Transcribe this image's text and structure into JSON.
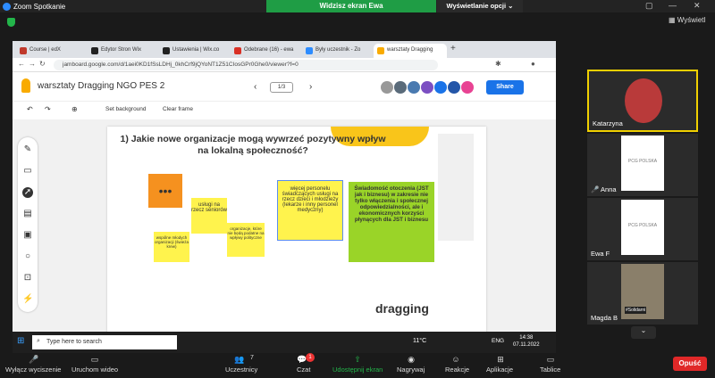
{
  "zoom": {
    "window_title": "Zoom Spotkanie",
    "share_banner": "Widzisz ekran Ewa",
    "view_options": "Wyświetlanie opcji ⌄",
    "gallery_view": "Wyświetl",
    "leave": "Opuść"
  },
  "browser": {
    "tabs": [
      "Course | edX",
      "Edytor Stron Wix",
      "Ustawienia | Wix.co",
      "Odebrane (16) - ewa",
      "Były uczestnik - Zo",
      "warsztaty Dragging"
    ],
    "tab_colors": [
      "#c0392b",
      "#222222",
      "#222222",
      "#d93025",
      "#2d8cff",
      "#f9ab00"
    ],
    "url": "jamboard.google.com/d/1aei0KD1fSsLDHj_0khCrf9jQYoNT1Z51CIosGPr0Ghe0/viewer?f=0"
  },
  "jamboard": {
    "title": "warsztaty Dragging NGO PES 2",
    "pager": "1/3",
    "share": "Share",
    "set_background": "Set background",
    "clear_frame": "Clear frame"
  },
  "board": {
    "question": "1) Jakie nowe organizacje mogą wywrzeć pozytywny wpływ na lokalną społeczność?",
    "notes": {
      "dots": "•••",
      "uslugi": "usługi na rzecz seniorów",
      "wiecej": "więcej personelu świadczących usługi na rzecz dzieci i młodzieży (lekarze i inny personel medyczny)",
      "swiadomosc": "Świadomość otoczenia (JST jak i biznesu) w zakresie nie tylko włączenia i społecznej odpowiedzialności, ale i ekonomicznych korzyści płynących dla JST i biznesu",
      "organizacje": "organizacje, które nie będą podatne na wpływy polityczne",
      "wspolne": "wspólne młodych organizacji (świeża krew)"
    },
    "logo": "dragging"
  },
  "taskbar": {
    "search": "Type here to search",
    "weather": "11°C",
    "lang": "ENG",
    "time": "14:38",
    "date": "07.11.2022"
  },
  "participants": [
    {
      "name": "Katarzyna"
    },
    {
      "name": "Anna"
    },
    {
      "name": "Ewa F"
    },
    {
      "name": "Magda B"
    }
  ],
  "pcg_logo": "PCG POLSKA",
  "solidarity_label": "#Solidarni",
  "bottom_bar": {
    "mute": "Wyłącz wyciszenie",
    "video": "Uruchom wideo",
    "participants": "Uczestnicy",
    "participants_count": "7",
    "chat": "Czat",
    "chat_badge": "1",
    "share": "Udostępnij ekran",
    "record": "Nagrywaj",
    "reactions": "Reakcje",
    "apps": "Aplikacje",
    "whiteboards": "Tablice"
  }
}
